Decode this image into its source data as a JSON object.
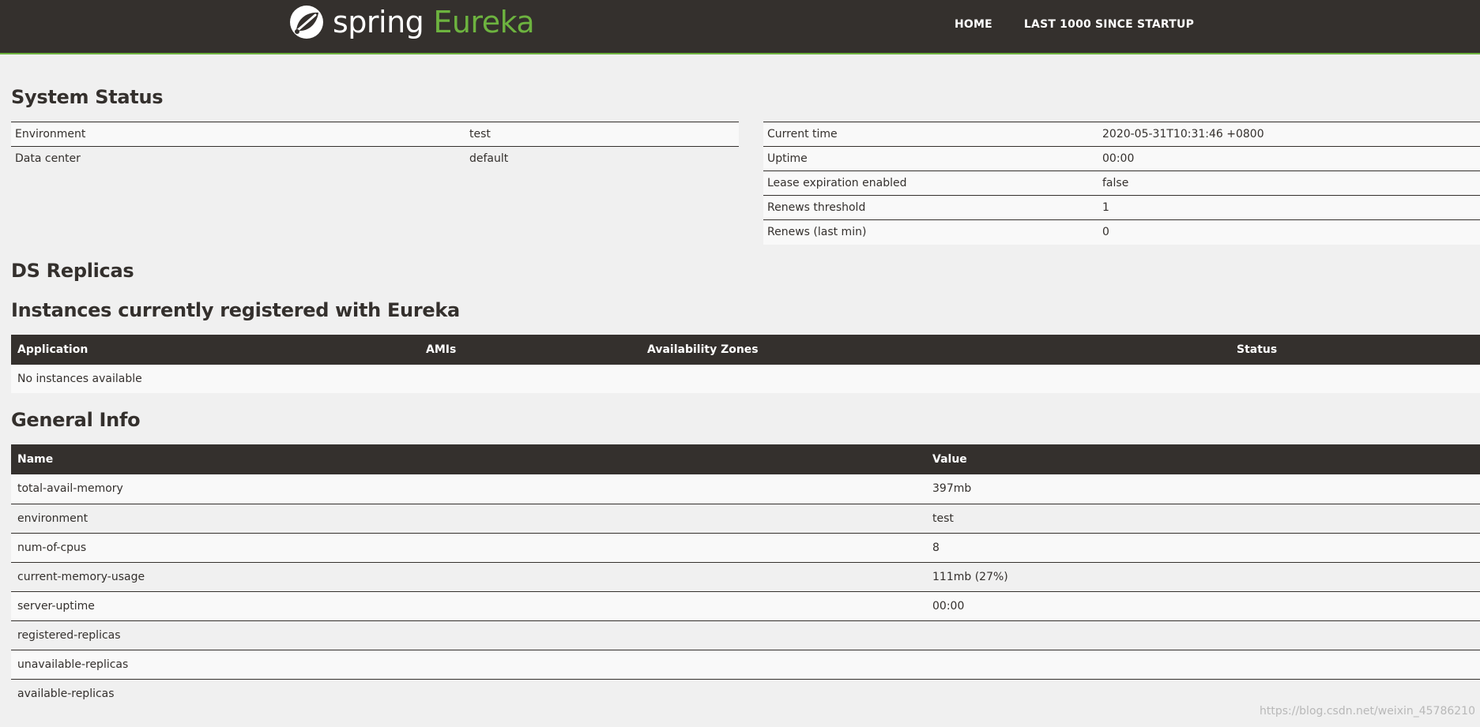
{
  "navbar": {
    "brand_spring": "spring",
    "brand_eureka": "Eureka",
    "links": [
      "HOME",
      "LAST 1000 SINCE STARTUP"
    ],
    "brand_color": "#6db33f",
    "bg_color": "#34302d"
  },
  "system_status": {
    "title": "System Status",
    "left": [
      {
        "label": "Environment",
        "value": "test"
      },
      {
        "label": "Data center",
        "value": "default"
      }
    ],
    "right": [
      {
        "label": "Current time",
        "value": "2020-05-31T10:31:46 +0800"
      },
      {
        "label": "Uptime",
        "value": "00:00"
      },
      {
        "label": "Lease expiration enabled",
        "value": "false"
      },
      {
        "label": "Renews threshold",
        "value": "1"
      },
      {
        "label": "Renews (last min)",
        "value": "0"
      }
    ]
  },
  "ds_replicas": {
    "title": "DS Replicas"
  },
  "instances": {
    "title": "Instances currently registered with Eureka",
    "headers": [
      "Application",
      "AMIs",
      "Availability Zones",
      "Status"
    ],
    "empty_text": "No instances available"
  },
  "general_info": {
    "title": "General Info",
    "headers": [
      "Name",
      "Value"
    ],
    "rows": [
      {
        "name": "total-avail-memory",
        "value": "397mb"
      },
      {
        "name": "environment",
        "value": "test"
      },
      {
        "name": "num-of-cpus",
        "value": "8"
      },
      {
        "name": "current-memory-usage",
        "value": "111mb (27%)"
      },
      {
        "name": "server-uptime",
        "value": "00:00"
      },
      {
        "name": "registered-replicas",
        "value": ""
      },
      {
        "name": "unavailable-replicas",
        "value": ""
      },
      {
        "name": "available-replicas",
        "value": ""
      }
    ]
  },
  "watermark": "https://blog.csdn.net/weixin_45786210"
}
